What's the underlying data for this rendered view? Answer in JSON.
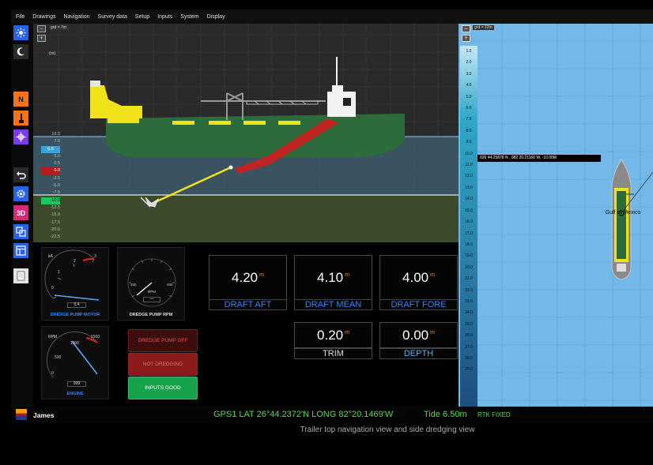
{
  "menu": [
    "File",
    "Drawings",
    "Navigation",
    "Survey data",
    "Setup",
    "Inputs",
    "System",
    "Display"
  ],
  "toolbar_icons": [
    "sun-icon",
    "moon-icon",
    "north-up-icon",
    "dredge-pipe-icon",
    "target-icon",
    "undo-icon",
    "settings-icon",
    "3d-icon",
    "layers-icon",
    "layout-icon",
    "notes-icon"
  ],
  "toolbar_3d_label": "3D",
  "toolbar_north_label": "N",
  "side_view": {
    "grid_label": "grd = 7m",
    "unit_label": "(m)",
    "depth_scale": [
      "10.0",
      "7.5",
      "5.0",
      "2.5",
      "0.0",
      "-2.5",
      "-5.0",
      "-7.5",
      "-10.0",
      "-12.5",
      "-15.0",
      "-17.5",
      "-20.0",
      "-22.5"
    ],
    "waterline_value": "6.5",
    "draghead_depth": "-10.0"
  },
  "gauges": {
    "pump_motor": {
      "label": "DREDGE PUMP MOTOR",
      "unit": "kA",
      "ticks": [
        "0",
        "1",
        "2",
        "3"
      ],
      "reading": "0.4"
    },
    "pump_rpm": {
      "label": "DREDGE PUMP RPM",
      "unit": "RPM",
      "ticks": [
        "0",
        "50",
        "100",
        "150",
        "200",
        "250",
        "300",
        "350",
        "400"
      ],
      "reading": "—"
    },
    "engine": {
      "label": "ENGINE",
      "unit": "RPM",
      "ticks": [
        "0",
        "500",
        "1000",
        "1500"
      ],
      "reading": "999"
    }
  },
  "status_buttons": {
    "pump_off": "DREDGE PUMP OFF",
    "not_dredging": "NOT DREDGING",
    "inputs_good": "INPUTS GOOD"
  },
  "readouts": {
    "draft_aft": {
      "value": "4.20",
      "unit": "m",
      "label": "DRAFT AFT"
    },
    "draft_mean": {
      "value": "4.10",
      "unit": "m",
      "label": "DRAFT MEAN"
    },
    "draft_fore": {
      "value": "4.00",
      "unit": "m",
      "label": "DRAFT FORE"
    },
    "trim": {
      "value": "0.20",
      "unit": "m",
      "label": "TRIM"
    },
    "depth": {
      "value": "0.00",
      "unit": "m",
      "label": "DEPTH"
    }
  },
  "top_view": {
    "grid_label": "grd = 22m",
    "depth_scale": [
      "1.0",
      "2.0",
      "3.0",
      "4.0",
      "5.0",
      "6.0",
      "7.0",
      "8.0",
      "9.0",
      "10.0",
      "11.0",
      "12.0",
      "13.0",
      "14.0",
      "15.0",
      "16.0",
      "17.0",
      "18.0",
      "19.0",
      "20.0",
      "21.0",
      "22.0",
      "23.0",
      "24.0",
      "25.0",
      "26.0",
      "27.0",
      "28.0",
      "29.0"
    ],
    "cursor_readout": "026 44.25878 N , 082 20.21166 W, -10.00M",
    "vessel_label": "Gulf of Mexico"
  },
  "statusbar": {
    "user": "James",
    "gps": "GPS1 LAT 26°44.2372'N  LONG 82°20.1469'W",
    "tide": "Tide  6.50m",
    "rtk": "RTK FIXED"
  },
  "caption": "Trailer top navigation view and side dredging view",
  "colors": {
    "accent_blue": "#3b82f6",
    "hull_green": "#2e6b3a",
    "deck_yellow": "#f0e21a",
    "water_blue": "#72b8e8",
    "status_green": "#4fd84f",
    "alarm_red": "#8b1a1a",
    "ok_green": "#16a34a"
  }
}
